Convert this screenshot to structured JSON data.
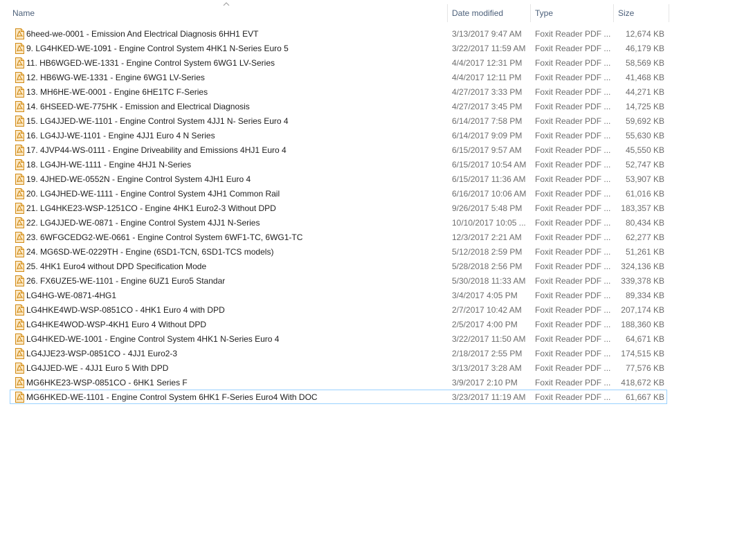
{
  "columns": {
    "name": "Name",
    "date": "Date modified",
    "type": "Type",
    "size": "Size"
  },
  "file_icon": "foxit-pdf-icon",
  "colors": {
    "header_text": "#4c607a",
    "focus_border": "#99d1ff",
    "icon_orange": "#f5a623"
  },
  "files": [
    {
      "name": "6heed-we-0001 - Emission And Electrical Diagnosis 6HH1 EVT",
      "date": "3/13/2017 9:47 AM",
      "type": "Foxit Reader PDF ...",
      "size": "12,674 KB"
    },
    {
      "name": "9. LG4HKED-WE-1091 - Engine Control System 4HK1 N-Series Euro 5",
      "date": "3/22/2017 11:59 AM",
      "type": "Foxit Reader PDF ...",
      "size": "46,179 KB"
    },
    {
      "name": "11. HB6WGED-WE-1331 - Engine Control System 6WG1 LV-Series",
      "date": "4/4/2017 12:31 PM",
      "type": "Foxit Reader PDF ...",
      "size": "58,569 KB"
    },
    {
      "name": "12. HB6WG-WE-1331 - Engine 6WG1 LV-Series",
      "date": "4/4/2017 12:11 PM",
      "type": "Foxit Reader PDF ...",
      "size": "41,468 KB"
    },
    {
      "name": "13. MH6HE-WE-0001 - Engine 6HE1TC F-Series",
      "date": "4/27/2017 3:33 PM",
      "type": "Foxit Reader PDF ...",
      "size": "44,271 KB"
    },
    {
      "name": "14. 6HSEED-WE-775HK - Emission and Electrical Diagnosis",
      "date": "4/27/2017 3:45 PM",
      "type": "Foxit Reader PDF ...",
      "size": "14,725 KB"
    },
    {
      "name": "15. LG4JJED-WE-1101 - Engine Control System 4JJ1 N- Series Euro 4",
      "date": "6/14/2017 7:58 PM",
      "type": "Foxit Reader PDF ...",
      "size": "59,692 KB"
    },
    {
      "name": "16. LG4JJ-WE-1101 - Engine 4JJ1 Euro 4  N Series",
      "date": "6/14/2017 9:09 PM",
      "type": "Foxit Reader PDF ...",
      "size": "55,630 KB"
    },
    {
      "name": "17. 4JVP44-WS-0111 -  Engine Driveability and Emissions 4HJ1 Euro 4",
      "date": "6/15/2017 9:57 AM",
      "type": "Foxit Reader PDF ...",
      "size": "45,550 KB"
    },
    {
      "name": "18. LG4JH-WE-1111 - Engine 4HJ1 N-Series",
      "date": "6/15/2017 10:54 AM",
      "type": "Foxit Reader PDF ...",
      "size": "52,747 KB"
    },
    {
      "name": "19. 4JHED-WE-0552N - Engine Control System 4JH1 Euro 4",
      "date": "6/15/2017 11:36 AM",
      "type": "Foxit Reader PDF ...",
      "size": "53,907 KB"
    },
    {
      "name": "20. LG4JHED-WE-1111 - Engine Control System 4JH1 Common Rail",
      "date": "6/16/2017 10:06 AM",
      "type": "Foxit Reader PDF ...",
      "size": "61,016 KB"
    },
    {
      "name": "21. LG4HKE23-WSP-1251CO - Engine  4HK1 Euro2-3 Without DPD",
      "date": "9/26/2017 5:48 PM",
      "type": "Foxit Reader PDF ...",
      "size": "183,357 KB"
    },
    {
      "name": "22. LG4JJED-WE-0871 - Engine Control System 4JJ1 N-Series",
      "date": "10/10/2017 10:05 ...",
      "type": "Foxit Reader PDF ...",
      "size": "80,434 KB"
    },
    {
      "name": "23. 6WFGCEDG2-WE-0661 - Engine Control System 6WF1-TC, 6WG1-TC",
      "date": "12/3/2017 2:21 AM",
      "type": "Foxit Reader PDF ...",
      "size": "62,277 KB"
    },
    {
      "name": "24. MG6SD-WE-0229TH - Engine (6SD1-TCN, 6SD1-TCS models)",
      "date": "5/12/2018 2:59 PM",
      "type": "Foxit Reader PDF ...",
      "size": "51,261 KB"
    },
    {
      "name": "25. 4HK1 Euro4 without DPD Specification Mode",
      "date": "5/28/2018 2:56 PM",
      "type": "Foxit Reader PDF ...",
      "size": "324,136 KB"
    },
    {
      "name": "26. FX6UZE5-WE-1101 - Engine 6UZ1 Euro5 Standar",
      "date": "5/30/2018 11:33 AM",
      "type": "Foxit Reader PDF ...",
      "size": "339,378 KB"
    },
    {
      "name": "LG4HG-WE-0871-4HG1",
      "date": "3/4/2017 4:05 PM",
      "type": "Foxit Reader PDF ...",
      "size": "89,334 KB"
    },
    {
      "name": "LG4HKE4WD-WSP-0851CO - 4HK1 Euro 4 with DPD",
      "date": "2/7/2017 10:42 AM",
      "type": "Foxit Reader PDF ...",
      "size": "207,174 KB"
    },
    {
      "name": "LG4HKE4WOD-WSP-4KH1 Euro 4 Without DPD",
      "date": "2/5/2017 4:00 PM",
      "type": "Foxit Reader PDF ...",
      "size": "188,360 KB"
    },
    {
      "name": "LG4HKED-WE-1001 - Engine Control System 4HK1 N-Series Euro 4",
      "date": "3/22/2017 11:50 AM",
      "type": "Foxit Reader PDF ...",
      "size": "64,671 KB"
    },
    {
      "name": "LG4JJE23-WSP-0851CO - 4JJ1 Euro2-3",
      "date": "2/18/2017 2:55 PM",
      "type": "Foxit Reader PDF ...",
      "size": "174,515 KB"
    },
    {
      "name": "LG4JJED-WE - 4JJ1 Euro 5 With DPD",
      "date": "3/13/2017 3:28 AM",
      "type": "Foxit Reader PDF ...",
      "size": "77,576 KB"
    },
    {
      "name": "MG6HKE23-WSP-0851CO - 6HK1 Series F",
      "date": "3/9/2017 2:10 PM",
      "type": "Foxit Reader PDF ...",
      "size": "418,672 KB"
    },
    {
      "name": "MG6HKED-WE-1101 - Engine Control System 6HK1 F-Series Euro4 With DOC",
      "date": "3/23/2017 11:19 AM",
      "type": "Foxit Reader PDF ...",
      "size": "61,667 KB",
      "focused": true
    }
  ]
}
